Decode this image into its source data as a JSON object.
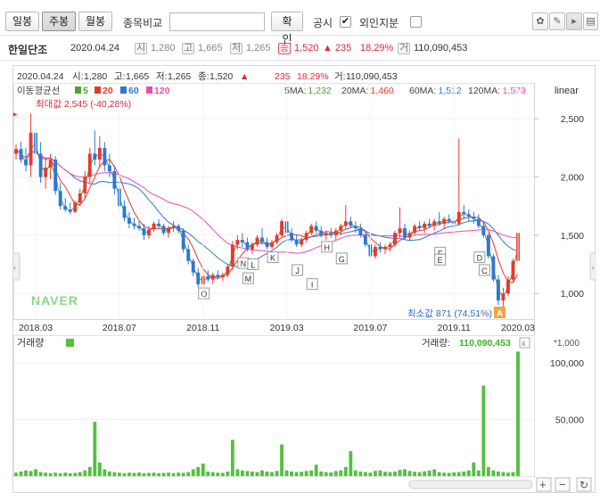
{
  "toolbar": {
    "tabs": [
      "일봉",
      "주봉",
      "월봉"
    ],
    "active_tab": "주봉",
    "compare_label": "종목비교",
    "compare_placeholder": "",
    "confirm_label": "확인",
    "disclosure_label": "공시",
    "disclosure_checked": true,
    "foreign_label": "외인지분",
    "foreign_checked": false,
    "icons": [
      "light-bulb-icon",
      "pencil-icon",
      "cursor-icon",
      "print-icon"
    ]
  },
  "info": {
    "name": "한일단조",
    "date": "2020.04.24",
    "open_icon": "시",
    "open": "1,280",
    "high_icon": "고",
    "high": "1,665",
    "low_icon": "저",
    "low": "1,265",
    "close_icon": "종",
    "close": "1,520",
    "change": "▲ 235",
    "change_pct": "18.29%",
    "volume_icon": "거",
    "volume": "110,090,453",
    "up_color": "#e0283c"
  },
  "chart_data": {
    "type": "candlestick",
    "scale": "linear",
    "header": {
      "date": "2020.04.24",
      "open_label": "시:",
      "open": "1,280",
      "high_label": "고:",
      "high": "1,665",
      "low_label": "저:",
      "low": "1,265",
      "close_label": "종:",
      "close": "1,520",
      "arrow": "▲",
      "change": "235",
      "change_pct": "18.29%",
      "volume_label": "거:",
      "volume": "110,090,453"
    },
    "ma_label": "이동평균선",
    "ma_legend": [
      {
        "period": "5",
        "color": "#4aa635"
      },
      {
        "period": "20",
        "color": "#e53a2f"
      },
      {
        "period": "60",
        "color": "#2d78d6"
      },
      {
        "period": "120",
        "color": "#ef4ab3"
      }
    ],
    "ma_values": [
      {
        "label": "5MA:",
        "value": "1,232",
        "color": "#4aa635"
      },
      {
        "label": "20MA:",
        "value": "1,460",
        "color": "#e53a2f"
      },
      {
        "label": "60MA:",
        "value": "1,512",
        "color": "#2d78d6"
      },
      {
        "label": "120MA:",
        "value": "1,573",
        "color": "#ef4ab3"
      }
    ],
    "max_label": "최대값 2,545 (-40,28%)",
    "min_label": "최소값 871 (74,51%)",
    "watermark": "NAVER",
    "scale_label": "linear",
    "y_ticks": [
      2500,
      2000,
      1500,
      1000
    ],
    "ylim": [
      780,
      2800
    ],
    "x_ticks": [
      "2018.03",
      "2018.07",
      "2018.11",
      "2019.03",
      "2019.07",
      "2019.11",
      "2020.03"
    ],
    "disclosure_markers": [
      "O",
      "N",
      "M",
      "L",
      "K",
      "J",
      "I",
      "H",
      "G",
      "F",
      "E",
      "D",
      "C"
    ],
    "volume_title": "거래량",
    "volume_value_label": "거래량:",
    "volume_value": "110,090,453",
    "volume_unit": "*1,000",
    "volume_ticks": [
      100000,
      50000
    ],
    "volume_ylim": [
      0,
      112000
    ],
    "candles": [
      [
        2200,
        2280,
        2150,
        2240
      ],
      [
        2240,
        2300,
        2120,
        2150
      ],
      [
        2150,
        2250,
        2050,
        2100
      ],
      [
        2100,
        2545,
        2000,
        2380
      ],
      [
        2380,
        2420,
        2150,
        2200
      ],
      [
        2200,
        2300,
        1950,
        2000
      ],
      [
        2000,
        2150,
        1900,
        2080
      ],
      [
        2080,
        2200,
        1980,
        2150
      ],
      [
        2150,
        2180,
        1850,
        1880
      ],
      [
        1880,
        1950,
        1720,
        1750
      ],
      [
        1750,
        1820,
        1700,
        1720
      ],
      [
        1720,
        1780,
        1680,
        1700
      ],
      [
        1700,
        1800,
        1690,
        1780
      ],
      [
        1780,
        1900,
        1750,
        1860
      ],
      [
        1860,
        2050,
        1820,
        2000
      ],
      [
        2000,
        2250,
        1950,
        2200
      ],
      [
        2200,
        2400,
        2100,
        2150
      ],
      [
        2150,
        2350,
        2080,
        2250
      ],
      [
        2250,
        2300,
        2050,
        2100
      ],
      [
        2100,
        2200,
        2000,
        2050
      ],
      [
        2050,
        2100,
        1850,
        1900
      ],
      [
        1900,
        1950,
        1700,
        1750
      ],
      [
        1750,
        1800,
        1620,
        1650
      ],
      [
        1650,
        1700,
        1560,
        1600
      ],
      [
        1600,
        1650,
        1550,
        1580
      ],
      [
        1580,
        1620,
        1540,
        1560
      ],
      [
        1560,
        1600,
        1460,
        1500
      ],
      [
        1500,
        1580,
        1470,
        1550
      ],
      [
        1550,
        1620,
        1530,
        1600
      ],
      [
        1600,
        1640,
        1560,
        1580
      ],
      [
        1580,
        1600,
        1500,
        1520
      ],
      [
        1520,
        1580,
        1480,
        1560
      ],
      [
        1560,
        1620,
        1530,
        1580
      ],
      [
        1580,
        1600,
        1520,
        1540
      ],
      [
        1540,
        1560,
        1350,
        1380
      ],
      [
        1380,
        1420,
        1250,
        1280
      ],
      [
        1280,
        1300,
        1150,
        1180
      ],
      [
        1180,
        1220,
        1050,
        1080
      ],
      [
        1080,
        1200,
        950,
        1150
      ],
      [
        1150,
        1200,
        1100,
        1120
      ],
      [
        1120,
        1180,
        1080,
        1160
      ],
      [
        1160,
        1200,
        1120,
        1140
      ],
      [
        1140,
        1180,
        1110,
        1160
      ],
      [
        1160,
        1250,
        1140,
        1230
      ],
      [
        1230,
        1450,
        1200,
        1420
      ],
      [
        1420,
        1500,
        1380,
        1460
      ],
      [
        1460,
        1520,
        1400,
        1440
      ],
      [
        1440,
        1480,
        1360,
        1380
      ],
      [
        1380,
        1440,
        1340,
        1420
      ],
      [
        1420,
        1500,
        1400,
        1480
      ],
      [
        1480,
        1560,
        1420,
        1440
      ],
      [
        1440,
        1480,
        1380,
        1400
      ],
      [
        1400,
        1460,
        1380,
        1440
      ],
      [
        1440,
        1520,
        1420,
        1500
      ],
      [
        1500,
        1640,
        1480,
        1620
      ],
      [
        1620,
        1660,
        1500,
        1520
      ],
      [
        1520,
        1560,
        1440,
        1460
      ],
      [
        1460,
        1500,
        1400,
        1420
      ],
      [
        1420,
        1480,
        1400,
        1460
      ],
      [
        1460,
        1540,
        1440,
        1520
      ],
      [
        1520,
        1600,
        1500,
        1580
      ],
      [
        1580,
        1620,
        1520,
        1540
      ],
      [
        1540,
        1580,
        1480,
        1500
      ],
      [
        1500,
        1540,
        1460,
        1520
      ],
      [
        1520,
        1560,
        1480,
        1500
      ],
      [
        1500,
        1560,
        1460,
        1540
      ],
      [
        1540,
        1600,
        1500,
        1580
      ],
      [
        1580,
        1760,
        1550,
        1620
      ],
      [
        1620,
        1660,
        1560,
        1580
      ],
      [
        1580,
        1620,
        1520,
        1560
      ],
      [
        1560,
        1600,
        1480,
        1500
      ],
      [
        1500,
        1540,
        1400,
        1420
      ],
      [
        1420,
        1460,
        1300,
        1320
      ],
      [
        1320,
        1420,
        1300,
        1400
      ],
      [
        1400,
        1440,
        1350,
        1380
      ],
      [
        1380,
        1420,
        1340,
        1400
      ],
      [
        1400,
        1440,
        1360,
        1420
      ],
      [
        1420,
        1540,
        1400,
        1520
      ],
      [
        1520,
        1740,
        1480,
        1560
      ],
      [
        1560,
        1600,
        1460,
        1480
      ],
      [
        1480,
        1540,
        1450,
        1520
      ],
      [
        1520,
        1600,
        1500,
        1580
      ],
      [
        1580,
        1620,
        1540,
        1560
      ],
      [
        1560,
        1620,
        1520,
        1600
      ],
      [
        1600,
        1640,
        1560,
        1580
      ],
      [
        1580,
        1640,
        1540,
        1620
      ],
      [
        1620,
        1700,
        1580,
        1600
      ],
      [
        1600,
        1660,
        1560,
        1640
      ],
      [
        1640,
        1680,
        1600,
        1620
      ],
      [
        1620,
        1660,
        1560,
        1600
      ],
      [
        1600,
        2330,
        1580,
        1700
      ],
      [
        1700,
        1760,
        1640,
        1680
      ],
      [
        1680,
        1720,
        1620,
        1660
      ],
      [
        1660,
        1700,
        1600,
        1640
      ],
      [
        1640,
        1680,
        1560,
        1580
      ],
      [
        1580,
        1620,
        1480,
        1500
      ],
      [
        1500,
        1520,
        1300,
        1320
      ],
      [
        1320,
        1340,
        1100,
        1120
      ],
      [
        1120,
        1160,
        900,
        940
      ],
      [
        940,
        1050,
        871,
        1000
      ],
      [
        1000,
        1150,
        980,
        1120
      ],
      [
        1120,
        1300,
        1100,
        1280
      ],
      [
        1280,
        1665,
        1265,
        1520
      ]
    ],
    "volumes": [
      3000,
      4000,
      5000,
      4500,
      6000,
      3500,
      3000,
      2500,
      3000,
      2500,
      3000,
      2500,
      2800,
      3500,
      5000,
      8000,
      48000,
      12000,
      6000,
      4000,
      3500,
      3000,
      2500,
      3000,
      2800,
      3200,
      2500,
      2800,
      3000,
      2500,
      2800,
      3000,
      2500,
      3000,
      2800,
      3500,
      6000,
      8000,
      11000,
      4000,
      3500,
      3000,
      2800,
      4000,
      32000,
      6000,
      5000,
      4500,
      4000,
      3500,
      5000,
      4000,
      3500,
      4500,
      28000,
      5000,
      4000,
      3500,
      3800,
      4500,
      5000,
      10000,
      4000,
      3500,
      3200,
      4500,
      5000,
      8000,
      22000,
      5000,
      4000,
      3500,
      3000,
      4500,
      5000,
      3800,
      3500,
      4000,
      5500,
      6000,
      4500,
      3800,
      3500,
      4200,
      5000,
      6000,
      3500,
      3000,
      2800,
      3200,
      3500,
      4000,
      5000,
      12000,
      5000,
      80000,
      8000,
      5000,
      4000,
      3500,
      3000,
      3500,
      110090
    ]
  }
}
